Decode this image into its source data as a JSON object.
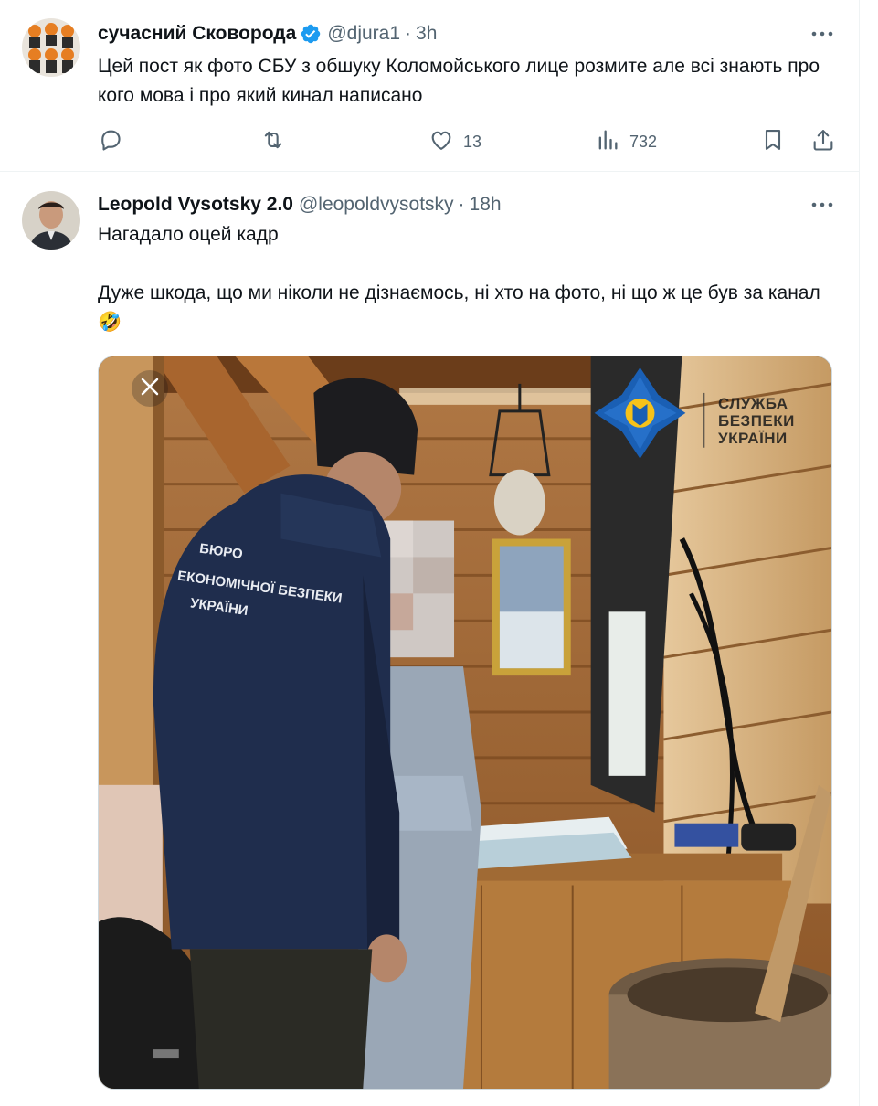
{
  "tweets": [
    {
      "display_name": "сучасний Сковорода",
      "verified": true,
      "handle": "@djura1",
      "separator": "·",
      "time": "3h",
      "text": "Цей пост як фото СБУ з обшуку Коломойського лице розмите але всі знають про кого мова і про який кинал написано",
      "actions": {
        "reply": {
          "icon": "reply-icon",
          "count": ""
        },
        "repost": {
          "icon": "repost-icon",
          "count": ""
        },
        "like": {
          "icon": "heart-icon",
          "count": "13"
        },
        "views": {
          "icon": "views-icon",
          "count": "732"
        },
        "bookmark": {
          "icon": "bookmark-icon"
        },
        "share": {
          "icon": "share-icon"
        }
      }
    },
    {
      "display_name": "Leopold Vysotsky 2.0",
      "verified": false,
      "handle": "@leopoldvysotsky",
      "separator": "·",
      "time": "18h",
      "text_paragraphs": [
        "Нагадало оцей кадр",
        "Дуже шкода, що ми ніколи не дізнаємось, ні хто на фото, ні що ж це був за канал🤣"
      ],
      "media": {
        "close_icon": "close-icon",
        "watermark_lines": [
          "СЛУЖБА",
          "БЕЗПЕКИ",
          "УКРАЇНИ"
        ],
        "jacket_text": [
          "БЮРО",
          "ЕКОНОМІЧНОЇ БЕЗПЕКИ",
          "УКРАЇНИ"
        ]
      }
    }
  ],
  "colors": {
    "text_primary": "#0f1419",
    "text_secondary": "#536471",
    "verified_blue": "#1d9bf0",
    "divider": "#eff3f4",
    "sbu_blue": "#1a5fb4",
    "sbu_gold": "#f6c21a"
  }
}
